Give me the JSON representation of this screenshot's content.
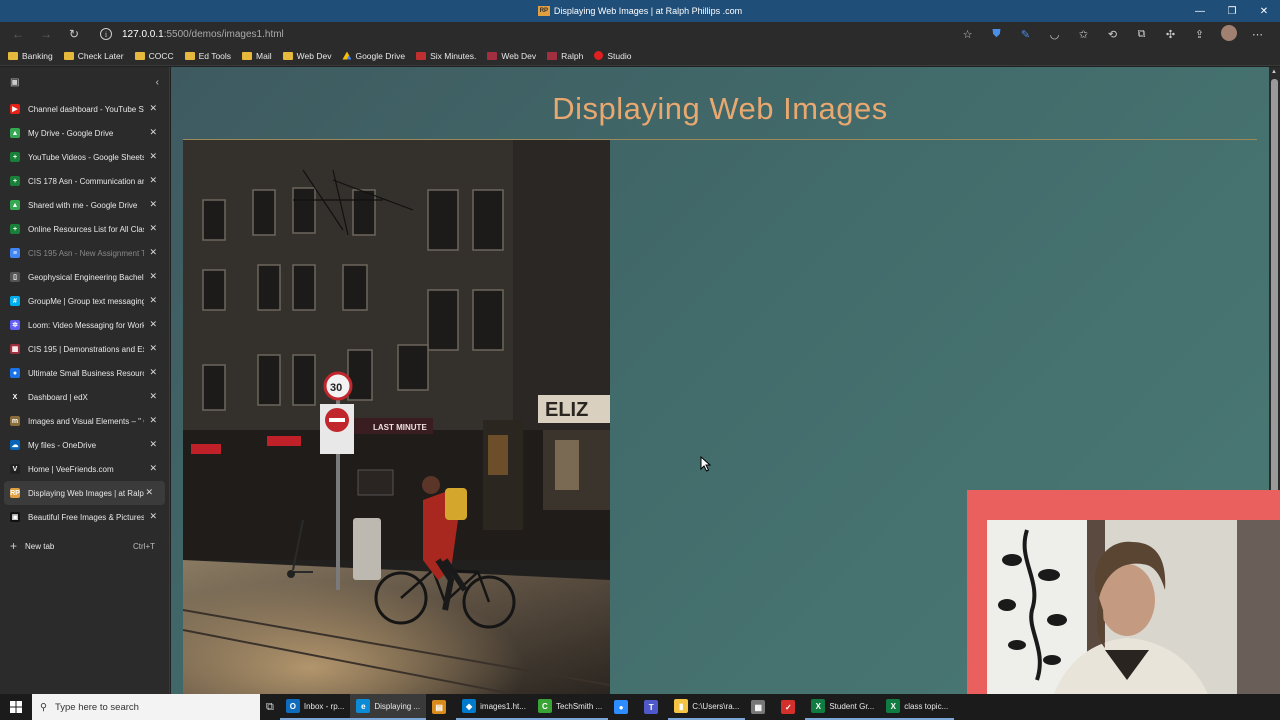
{
  "window": {
    "title": "Displaying Web Images | at Ralph Phillips .com",
    "logo_text": "RP",
    "controls": [
      "—",
      "❐",
      "✕"
    ]
  },
  "nav": {
    "back": "←",
    "forward": "→",
    "refresh": "↻",
    "info": "i",
    "url_host": "127.0.0.1",
    "url_path": ":5500/demos/images1.html"
  },
  "bookmarks": [
    {
      "label": "Banking",
      "icon": "folder"
    },
    {
      "label": "Check Later",
      "icon": "folder"
    },
    {
      "label": "COCC",
      "icon": "folder"
    },
    {
      "label": "Ed Tools",
      "icon": "folder"
    },
    {
      "label": "Mail",
      "icon": "folder"
    },
    {
      "label": "Web Dev",
      "icon": "folder"
    },
    {
      "label": "Google Drive",
      "icon": "gdrive"
    },
    {
      "label": "Six Minutes.",
      "icon": "red"
    },
    {
      "label": "Web Dev",
      "icon": "maroon"
    },
    {
      "label": "Ralph",
      "icon": "maroon"
    },
    {
      "label": "Studio",
      "icon": "redcirc"
    }
  ],
  "tabs": [
    {
      "title": "Channel dashboard - YouTube St",
      "color": "#e62117",
      "glyph": "▶"
    },
    {
      "title": "My Drive - Google Drive",
      "color": "#34a853",
      "glyph": "▲"
    },
    {
      "title": "YouTube Videos - Google Sheets",
      "color": "#188038",
      "glyph": "+"
    },
    {
      "title": "CIS 178 Asn - Communication an",
      "color": "#188038",
      "glyph": "+"
    },
    {
      "title": "Shared with me - Google Drive",
      "color": "#34a853",
      "glyph": "▲"
    },
    {
      "title": "Online Resources List for All Clas",
      "color": "#188038",
      "glyph": "+"
    },
    {
      "title": "CIS 195 Asn - New Assignment T",
      "color": "#4285f4",
      "glyph": "≡"
    },
    {
      "title": "Geophysical Engineering Bachelo",
      "color": "#555555",
      "glyph": "▯"
    },
    {
      "title": "GroupMe | Group text messaging",
      "color": "#00aff0",
      "glyph": "#"
    },
    {
      "title": "Loom: Video Messaging for Work",
      "color": "#625df5",
      "glyph": "✲"
    },
    {
      "title": "CIS 195 | Demonstrations and Ex",
      "color": "#a03040",
      "glyph": "▦"
    },
    {
      "title": "Ultimate Small Business Resourc",
      "color": "#1a73e8",
      "glyph": "●"
    },
    {
      "title": "Dashboard | edX",
      "color": "#2b2b2b",
      "glyph": "X"
    },
    {
      "title": "Images and Visual Elements – \" C",
      "color": "#8a6d3b",
      "glyph": "m"
    },
    {
      "title": "My files - OneDrive",
      "color": "#0364b8",
      "glyph": "☁"
    },
    {
      "title": "Home | VeeFriends.com",
      "color": "#222222",
      "glyph": "V"
    },
    {
      "title": "Displaying Web Images | at Ralph",
      "color": "#e0a040",
      "glyph": "RP"
    },
    {
      "title": "Beautiful Free Images & Pictures",
      "color": "#111111",
      "glyph": "▣"
    }
  ],
  "active_tab_index": 16,
  "faded_tab_index": 6,
  "new_tab": {
    "label": "New tab",
    "shortcut": "Ctrl+T"
  },
  "page": {
    "heading": "Displaying Web Images",
    "photo_sign_text": "LAST MINUTE",
    "photo_speed_sign": "30",
    "photo_store_text": "ELIZ"
  },
  "taskbar": {
    "search_placeholder": "Type here to search",
    "items": [
      {
        "label": "Inbox - rp...",
        "color": "#0f6cbd",
        "glyph": "O"
      },
      {
        "label": "Displaying ...",
        "color": "#0c8ad6",
        "glyph": "e"
      },
      {
        "label": "",
        "color": "#d88a1b",
        "glyph": "▤"
      },
      {
        "label": "images1.ht...",
        "color": "#007acc",
        "glyph": "◆"
      },
      {
        "label": "TechSmith ...",
        "color": "#3aa335",
        "glyph": "C"
      },
      {
        "label": "",
        "color": "#2d8cff",
        "glyph": "●"
      },
      {
        "label": "",
        "color": "#5059c9",
        "glyph": "T"
      },
      {
        "label": "C:\\Users\\ra...",
        "color": "#f4c542",
        "glyph": "▮"
      },
      {
        "label": "",
        "color": "#777777",
        "glyph": "▦"
      },
      {
        "label": "",
        "color": "#d4302b",
        "glyph": "✓"
      },
      {
        "label": "Student Gr...",
        "color": "#107c41",
        "glyph": "X"
      },
      {
        "label": "class topic...",
        "color": "#107c41",
        "glyph": "X"
      }
    ]
  },
  "colors": {
    "heading": "#e8a870",
    "page_bg": "#426b6b",
    "webcam_frame": "#e9605f"
  }
}
